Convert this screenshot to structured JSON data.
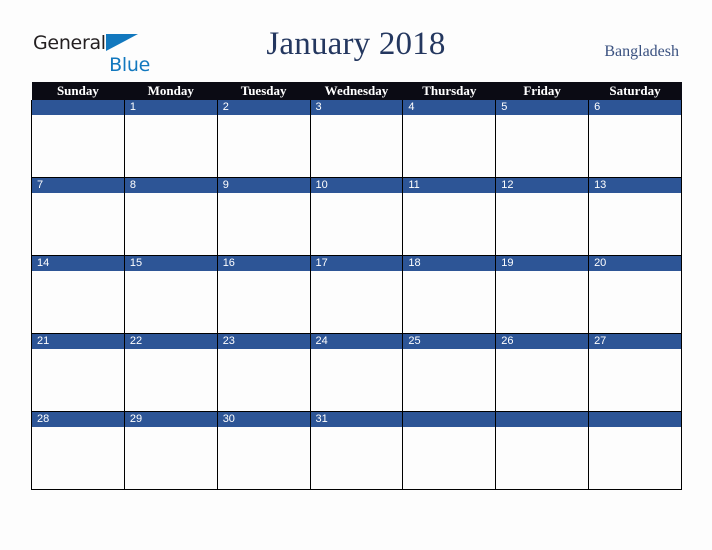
{
  "logo": {
    "word1": "General",
    "word2": "Blue",
    "triangle_color": "#1278be",
    "word1_color": "#231f20"
  },
  "header": {
    "title": "January 2018",
    "country": "Bangladesh",
    "title_color": "#24375f",
    "country_color": "#3a5180"
  },
  "calendar": {
    "weekday_headers": [
      "Sunday",
      "Monday",
      "Tuesday",
      "Wednesday",
      "Thursday",
      "Friday",
      "Saturday"
    ],
    "header_bg": "#0b0b14",
    "daynum_bg": "#2d5596",
    "cell_bg": "#fdfdfd",
    "border_color": "#000000",
    "weeks": [
      [
        "",
        "1",
        "2",
        "3",
        "4",
        "5",
        "6"
      ],
      [
        "7",
        "8",
        "9",
        "10",
        "11",
        "12",
        "13"
      ],
      [
        "14",
        "15",
        "16",
        "17",
        "18",
        "19",
        "20"
      ],
      [
        "21",
        "22",
        "23",
        "24",
        "25",
        "26",
        "27"
      ],
      [
        "28",
        "29",
        "30",
        "31",
        "",
        "",
        ""
      ]
    ]
  }
}
